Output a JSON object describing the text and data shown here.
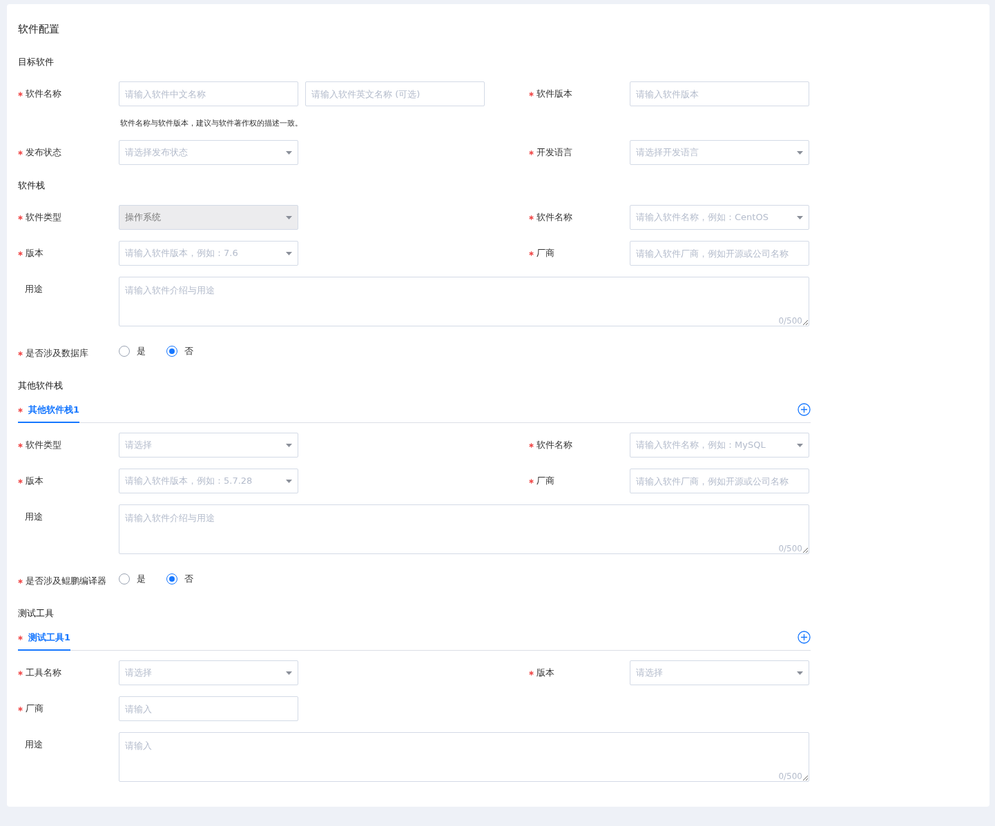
{
  "title": "软件配置",
  "sections": [
    {
      "heading": "目标软件",
      "rows": [
        {
          "fields": [
            {
              "label": "软件名称",
              "required": true,
              "controls": [
                {
                  "kind": "input",
                  "placeholder": "请输入软件中文名称"
                },
                {
                  "kind": "input",
                  "placeholder": "请输入软件英文名称 (可选)"
                }
              ]
            },
            {
              "label": "软件版本",
              "required": true,
              "controls": [
                {
                  "kind": "input",
                  "placeholder": "请输入软件版本"
                }
              ]
            }
          ],
          "hint": "软件名称与软件版本，建议与软件著作权的描述一致。"
        },
        {
          "fields": [
            {
              "label": "发布状态",
              "required": true,
              "controls": [
                {
                  "kind": "select",
                  "placeholder": "请选择发布状态",
                  "disabled": false
                }
              ]
            },
            {
              "label": "开发语言",
              "required": true,
              "controls": [
                {
                  "kind": "select",
                  "placeholder": "请选择开发语言",
                  "disabled": false
                }
              ]
            }
          ]
        }
      ]
    },
    {
      "heading": "软件栈",
      "rows": [
        {
          "fields": [
            {
              "label": "软件类型",
              "required": true,
              "controls": [
                {
                  "kind": "select",
                  "value": "操作系统",
                  "disabled": true
                }
              ]
            },
            {
              "label": "软件名称",
              "required": true,
              "controls": [
                {
                  "kind": "select",
                  "placeholder": "请输入软件名称，例如：CentOS",
                  "disabled": false
                }
              ]
            }
          ]
        },
        {
          "fields": [
            {
              "label": "版本",
              "required": true,
              "controls": [
                {
                  "kind": "select",
                  "placeholder": "请输入软件版本，例如：7.6",
                  "disabled": false
                }
              ]
            },
            {
              "label": "厂商",
              "required": true,
              "controls": [
                {
                  "kind": "input",
                  "placeholder": "请输入软件厂商，例如开源或公司名称"
                }
              ]
            }
          ]
        },
        {
          "fields": [
            {
              "label": "用途",
              "required": false,
              "controls": [
                {
                  "kind": "textarea",
                  "placeholder": "请输入软件介绍与用途",
                  "counter": "0/500"
                }
              ]
            }
          ]
        },
        {
          "fields": [
            {
              "label": "是否涉及数据库",
              "required": true,
              "controls": [
                {
                  "kind": "radio",
                  "options": [
                    {
                      "label": "是",
                      "selected": false
                    },
                    {
                      "label": "否",
                      "selected": true
                    }
                  ]
                }
              ]
            }
          ]
        }
      ]
    },
    {
      "heading": "其他软件栈",
      "tab": {
        "label": "其他软件栈1",
        "required": true,
        "selected": true
      },
      "rows": [
        {
          "fields": [
            {
              "label": "软件类型",
              "required": true,
              "controls": [
                {
                  "kind": "select",
                  "placeholder": "请选择",
                  "disabled": false
                }
              ]
            },
            {
              "label": "软件名称",
              "required": true,
              "controls": [
                {
                  "kind": "select",
                  "placeholder": "请输入软件名称，例如：MySQL",
                  "disabled": false
                }
              ]
            }
          ]
        },
        {
          "fields": [
            {
              "label": "版本",
              "required": true,
              "controls": [
                {
                  "kind": "select",
                  "placeholder": "请输入软件版本，例如：5.7.28",
                  "disabled": false
                }
              ]
            },
            {
              "label": "厂商",
              "required": true,
              "controls": [
                {
                  "kind": "input",
                  "placeholder": "请输入软件厂商，例如开源或公司名称"
                }
              ]
            }
          ]
        },
        {
          "fields": [
            {
              "label": "用途",
              "required": false,
              "controls": [
                {
                  "kind": "textarea",
                  "placeholder": "请输入软件介绍与用途",
                  "counter": "0/500"
                }
              ]
            }
          ]
        },
        {
          "fields": [
            {
              "label": "是否涉及鲲鹏编译器",
              "required": true,
              "controls": [
                {
                  "kind": "radio",
                  "options": [
                    {
                      "label": "是",
                      "selected": false
                    },
                    {
                      "label": "否",
                      "selected": true
                    }
                  ]
                }
              ]
            }
          ]
        }
      ]
    },
    {
      "heading": "测试工具",
      "tab": {
        "label": "测试工具1",
        "required": true,
        "selected": true
      },
      "rows": [
        {
          "fields": [
            {
              "label": "工具名称",
              "required": true,
              "controls": [
                {
                  "kind": "select",
                  "placeholder": "请选择",
                  "disabled": false
                }
              ]
            },
            {
              "label": "版本",
              "required": true,
              "controls": [
                {
                  "kind": "select",
                  "placeholder": "请选择",
                  "disabled": false
                }
              ]
            }
          ]
        },
        {
          "fields": [
            {
              "label": "厂商",
              "required": true,
              "controls": [
                {
                  "kind": "input",
                  "placeholder": "请输入"
                }
              ]
            }
          ]
        },
        {
          "fields": [
            {
              "label": "用途",
              "required": false,
              "controls": [
                {
                  "kind": "textarea",
                  "placeholder": "请输入",
                  "counter": "0/500"
                }
              ]
            }
          ]
        }
      ]
    }
  ]
}
